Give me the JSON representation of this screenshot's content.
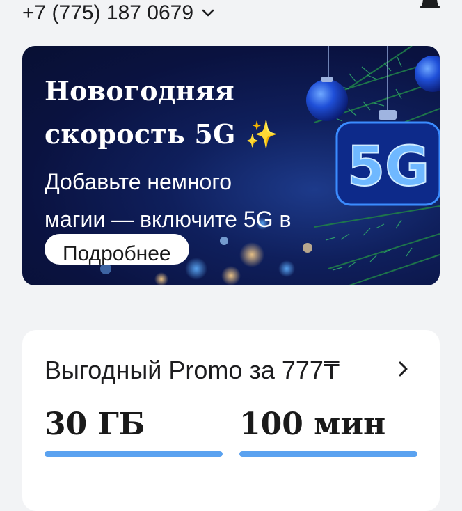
{
  "header": {
    "phone_number": "+7 (775) 187 0679",
    "dropdown_icon": "chevron-down-icon",
    "notifications_icon": "bell-icon"
  },
  "banner": {
    "title_line1": "Новогодняя",
    "title_line2": "скорость 5G ✨",
    "text_line1": "Добавьте немного",
    "text_line2": "магии — включите 5G в",
    "button_label": "Подробнее",
    "ornament_text": "5G",
    "colors": {
      "background": "#0a1240",
      "accent": "#2f7bff"
    }
  },
  "promo_card": {
    "title": "Выгодный Promo за 777₸",
    "chevron_icon": "chevron-right-icon",
    "metrics": [
      {
        "value": "30 ГБ",
        "progress": 1.0
      },
      {
        "value": "100 мин",
        "progress": 1.0
      }
    ],
    "colors": {
      "progress": "#5aa2f0"
    }
  }
}
